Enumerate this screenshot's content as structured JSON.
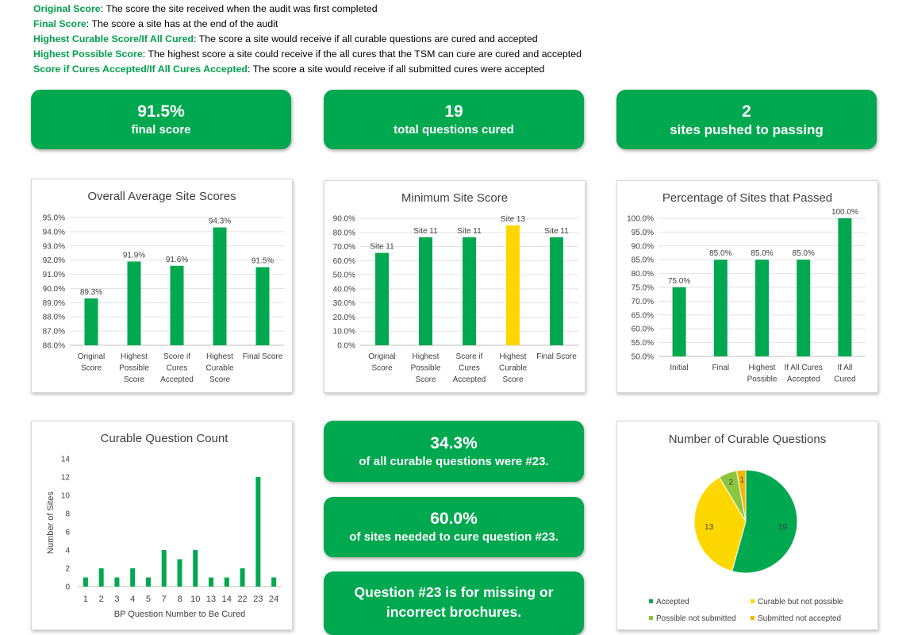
{
  "definitions": [
    {
      "term": "Original Score",
      "text": ": The score the site received when the audit was first completed"
    },
    {
      "term": "Final Score",
      "text": ": The score a site has at the end of the audit"
    },
    {
      "term": "Highest Curable Score/If All Cured",
      "text": ": The score a site would receive if all curable questions are cured and accepted"
    },
    {
      "term": "Highest Possible Score",
      "text": ": The highest score a site could receive if the all cures that the TSM can cure are cured and accepted"
    },
    {
      "term": "Score if Cures Accepted/If All Cures Accepted",
      "text": ": The score a site would receive if all submitted cures were accepted"
    }
  ],
  "kpis": {
    "final_score": {
      "value": "91.5%",
      "label": "final score"
    },
    "questions_cured": {
      "value": "19",
      "label": "total questions cured"
    },
    "sites_pushed": {
      "value": "2",
      "label": "sites pushed to passing"
    },
    "pct_23": {
      "value": "34.3%",
      "label": "of all curable questions were #23."
    },
    "pct_sites_23": {
      "value": "60.0%",
      "label": "of sites needed to cure question #23."
    },
    "q23_note": {
      "line1": "Question #23 is for missing or",
      "line2": "incorrect brochures."
    }
  },
  "colors": {
    "green": "#00a84f",
    "yellow": "#ffd700",
    "light_green": "#8cc63f",
    "orange_yellow": "#f5b800"
  },
  "chart_data": [
    {
      "id": "avg_scores",
      "type": "bar",
      "title": "Overall Average Site Scores",
      "categories": [
        [
          "Original",
          "Score"
        ],
        [
          "Highest",
          "Possible",
          "Score"
        ],
        [
          "Score if",
          "Cures",
          "Accepted"
        ],
        [
          "Highest",
          "Curable",
          "Score"
        ],
        [
          "Final Score"
        ]
      ],
      "values": [
        89.3,
        91.9,
        91.6,
        94.3,
        91.5
      ],
      "labels": [
        "89.3%",
        "91.9%",
        "91.6%",
        "94.3%",
        "91.5%"
      ],
      "ylim": [
        86,
        95
      ],
      "yticks": [
        "86.0%",
        "87.0%",
        "88.0%",
        "89.0%",
        "90.0%",
        "91.0%",
        "92.0%",
        "93.0%",
        "94.0%",
        "95.0%"
      ],
      "colors": [
        "#00a84f",
        "#00a84f",
        "#00a84f",
        "#00a84f",
        "#00a84f"
      ]
    },
    {
      "id": "min_score",
      "type": "bar",
      "title": "Minimum Site Score",
      "categories": [
        [
          "Original",
          "Score"
        ],
        [
          "Highest",
          "Possible",
          "Score"
        ],
        [
          "Score if",
          "Cures",
          "Accepted"
        ],
        [
          "Highest",
          "Curable",
          "Score"
        ],
        [
          "Final Score"
        ]
      ],
      "values": [
        65.5,
        76.5,
        76.5,
        85,
        76.5
      ],
      "labels": [
        "Site 11",
        "Site 11",
        "Site 11",
        "Site 13",
        "Site 11"
      ],
      "ylim": [
        0,
        90
      ],
      "yticks": [
        "0.0%",
        "10.0%",
        "20.0%",
        "30.0%",
        "40.0%",
        "50.0%",
        "60.0%",
        "70.0%",
        "80.0%",
        "90.0%"
      ],
      "colors": [
        "#00a84f",
        "#00a84f",
        "#00a84f",
        "#ffd700",
        "#00a84f"
      ]
    },
    {
      "id": "pct_passed",
      "type": "bar",
      "title": "Percentage of Sites that Passed",
      "categories": [
        [
          "Initial"
        ],
        [
          "Final"
        ],
        [
          "Highest",
          "Possible"
        ],
        [
          "If All Cures",
          "Accepted"
        ],
        [
          "If All",
          "Cured"
        ]
      ],
      "values": [
        75,
        85,
        85,
        85,
        100
      ],
      "labels": [
        "75.0%",
        "85.0%",
        "85.0%",
        "85.0%",
        "100.0%"
      ],
      "ylim": [
        50,
        100
      ],
      "yticks": [
        "50.0%",
        "55.0%",
        "60.0%",
        "65.0%",
        "70.0%",
        "75.0%",
        "80.0%",
        "85.0%",
        "90.0%",
        "95.0%",
        "100.0%"
      ],
      "colors": [
        "#00a84f",
        "#00a84f",
        "#00a84f",
        "#00a84f",
        "#00a84f"
      ]
    },
    {
      "id": "curable_count",
      "type": "bar",
      "title": "Curable Question Count",
      "xlabel": "BP Question Number to Be Cured",
      "ylabel": "Number of Sites",
      "categories": [
        "1",
        "2",
        "3",
        "4",
        "5",
        "7",
        "8",
        "10",
        "13",
        "14",
        "22",
        "23",
        "24"
      ],
      "values": [
        1,
        2,
        1,
        2,
        1,
        4,
        3,
        4,
        1,
        1,
        2,
        12,
        1
      ],
      "ylim": [
        0,
        14
      ],
      "yticks": [
        "0",
        "2",
        "4",
        "6",
        "8",
        "10",
        "12",
        "14"
      ]
    },
    {
      "id": "curable_pie",
      "type": "pie",
      "title": "Number of Curable Questions",
      "slices": [
        {
          "name": "Accepted",
          "value": 19,
          "color": "#00a84f"
        },
        {
          "name": "Curable but not possible",
          "value": 13,
          "color": "#ffd700"
        },
        {
          "name": "Possible not submitted",
          "value": 2,
          "color": "#8cc63f"
        },
        {
          "name": "Submitted not accepted",
          "value": 1,
          "color": "#f5b800"
        }
      ],
      "legend": "bottom"
    }
  ]
}
